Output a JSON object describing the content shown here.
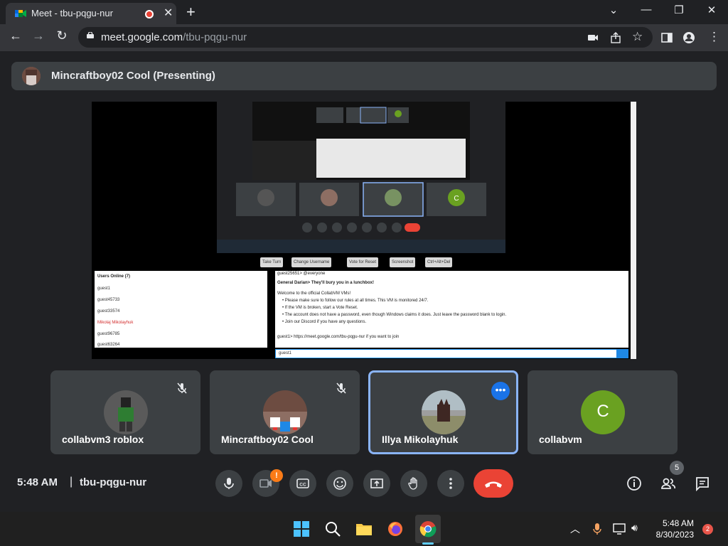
{
  "browser": {
    "tab_title": "Meet - tbu-pqgu-nur",
    "tab_close": "✕",
    "new_tab": "+",
    "url_host": "meet.google.com",
    "url_path": "/tbu-pqgu-nur"
  },
  "presenting": {
    "name": "Mincraftboy02 Cool (Presenting)"
  },
  "shared_screen": {
    "vm_buttons": [
      "Take Turn",
      "Change Username",
      "Vote for Reset",
      "Screenshot",
      "Ctrl+Alt+Del"
    ],
    "users_header": "Users Online (7)",
    "users": [
      "guest1",
      "guest45733",
      "guest33574",
      "Mikolaj Mikolayhuk",
      "guest96785",
      "guest63264"
    ],
    "chat": [
      "guest25651> @everyone",
      "General Darian> They'll bury you in a lunchbox!",
      "Welcome to the official CollabVM VMs!",
      "• Please make sure to follow our rules at all times. This VM is monitored 24/7.",
      "• If the VM is broken, start a Vote Reset.",
      "• The account does not have a password, even though Windows claims it does. Just leave the password blank to login.",
      "• Join our Discord if you have any questions.",
      "guest1> https://meet.google.com/tbu-pqgu-nur if you want to join"
    ],
    "chat_input": "guest1"
  },
  "tiles": [
    {
      "name": "collabvm3 roblox",
      "muted": true
    },
    {
      "name": "Mincraftboy02 Cool",
      "muted": true
    },
    {
      "name": "Illya Mikolayhuk",
      "muted": false
    },
    {
      "name": "collabvm",
      "avatar_letter": "C",
      "muted": false
    }
  ],
  "meeting": {
    "time": "5:48 AM",
    "separator": "|",
    "code": "tbu-pqgu-nur",
    "camera_warning": "!",
    "participants_count": "5"
  },
  "taskbar": {
    "time": "5:48 AM",
    "date": "8/30/2023",
    "notifications": "2"
  },
  "colors": {
    "background": "#202124",
    "tile": "#3c4043",
    "active_border": "#8ab4f8",
    "end_call": "#ea4335",
    "collabvm_avatar": "#6aa121"
  }
}
